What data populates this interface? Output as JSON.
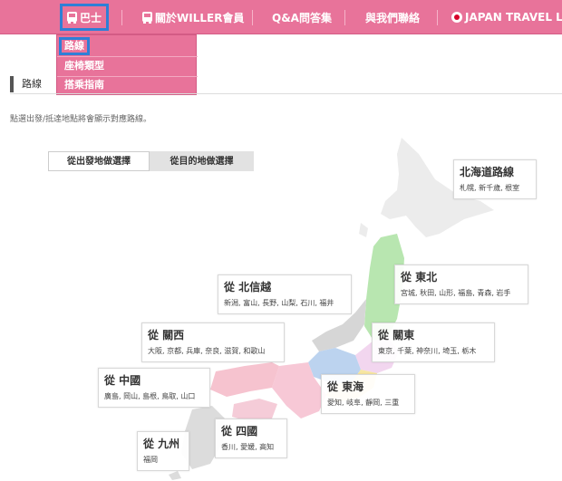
{
  "nav": {
    "items": [
      {
        "label": "巴士"
      },
      {
        "label": "關於WILLER會員"
      },
      {
        "label": "Q&A問答集"
      },
      {
        "label": "與我們聯絡"
      },
      {
        "label": "JAPAN TRAVEL LOG"
      }
    ]
  },
  "dropdown": {
    "items": [
      {
        "label": "路線"
      },
      {
        "label": "座椅類型"
      },
      {
        "label": "搭乘指南"
      }
    ]
  },
  "page": {
    "title": "路線",
    "instruction": "點選出發/抵達地點將會顯示對應路線。"
  },
  "tabs": {
    "origin": "從出發地做選擇",
    "destination": "從目的地做選擇"
  },
  "regions": [
    {
      "title": "北海道路線",
      "cities": "札幌, 新千歲, 根室"
    },
    {
      "title": "從 東北",
      "cities": "宮城, 秋田, 山形, 福島, 青森, 岩手"
    },
    {
      "title": "從 北信越",
      "cities": "新潟, 富山, 長野, 山梨, 石川, 福井"
    },
    {
      "title": "從 關東",
      "cities": "東京, 千葉, 神奈川, 埼玉, 栃木"
    },
    {
      "title": "從 關西",
      "cities": "大阪, 京都, 兵庫, 奈良, 滋賀, 和歌山"
    },
    {
      "title": "從 東海",
      "cities": "愛知, 岐阜, 靜岡, 三重"
    },
    {
      "title": "從 中國",
      "cities": "廣島, 岡山, 島根, 鳥取, 山口"
    },
    {
      "title": "從 四國",
      "cities": "香川, 愛媛, 高知"
    },
    {
      "title": "從 九州",
      "cities": "福岡"
    }
  ],
  "colors": {
    "nav_bg": "#e8739a",
    "highlight": "#2f7fd6",
    "hokkaido": "#ececec",
    "tohoku": "#b8e6b0",
    "hokushinetsu": "#d0d0d0",
    "kanto": "#f2d6ef",
    "kansai": "#f7c8d6",
    "tokai": "#f7e6a2",
    "chugoku": "#f6c3cf",
    "shikoku": "#f5ccd8",
    "kyushu": "#dcdcdc",
    "chubu": "#bcd3ef"
  }
}
